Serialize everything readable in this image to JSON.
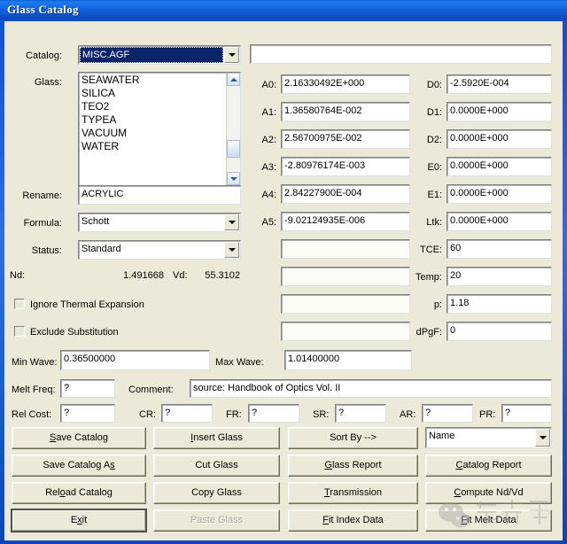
{
  "window": {
    "title": "Glass Catalog"
  },
  "catalog": {
    "label": "Catalog:",
    "value": "MISC.AGF",
    "options": [
      "MISC.AGF"
    ]
  },
  "top_field": {
    "value": "",
    "placeholder": ""
  },
  "glass": {
    "label": "Glass:",
    "items": [
      "SEAWATER",
      "SILICA",
      "TEO2",
      "TYPEA",
      "VACUUM",
      "WATER"
    ],
    "selected": ""
  },
  "rename": {
    "label": "Rename:",
    "value": "ACRYLIC"
  },
  "formula": {
    "label": "Formula:",
    "value": "Schott",
    "options": [
      "Schott"
    ]
  },
  "status": {
    "label": "Status:",
    "value": "Standard",
    "options": [
      "Standard"
    ]
  },
  "indices": {
    "nd_label": "Nd:",
    "nd_value": "1.491668",
    "vd_label": "Vd:",
    "vd_value": "55.3102"
  },
  "checkboxes": [
    {
      "label": "Ignore Thermal Expansion",
      "checked": false
    },
    {
      "label": "Exclude Substitution",
      "checked": false
    }
  ],
  "coefficients_a": [
    {
      "label": "A0:",
      "value": "2.16330492E+000"
    },
    {
      "label": "A1:",
      "value": "1.36580764E-002"
    },
    {
      "label": "A2:",
      "value": "2.56700975E-002"
    },
    {
      "label": "A3:",
      "value": "-2.80976174E-003"
    },
    {
      "label": "A4:",
      "value": "2.84227900E-004"
    },
    {
      "label": "A5:",
      "value": "-9.02124935E-006"
    },
    {
      "label": "",
      "value": ""
    },
    {
      "label": "",
      "value": ""
    },
    {
      "label": "",
      "value": ""
    },
    {
      "label": "",
      "value": ""
    },
    {
      "label": "",
      "value": ""
    }
  ],
  "coefficients_d": [
    {
      "label": "D0:",
      "value": "-2.5920E-004"
    },
    {
      "label": "D1:",
      "value": "0.0000E+000"
    },
    {
      "label": "D2:",
      "value": "0.0000E+000"
    },
    {
      "label": "E0:",
      "value": "0.0000E+000"
    },
    {
      "label": "E1:",
      "value": "0.0000E+000"
    },
    {
      "label": "Ltk:",
      "value": "0.0000E+000"
    },
    {
      "label": "TCE:",
      "value": "60"
    },
    {
      "label": "Temp:",
      "value": "20"
    },
    {
      "label": "p:",
      "value": "1.18"
    },
    {
      "label": "dPgF:",
      "value": "0"
    }
  ],
  "wave": {
    "min_label": "Min Wave:",
    "min_value": "0.36500000",
    "max_label": "Max Wave:",
    "max_value": "1.01400000"
  },
  "melt": {
    "freq_label": "Melt Freq:",
    "freq_value": "?",
    "comment_label": "Comment:",
    "comment_value": "source:  Handbook of Optics Vol. II"
  },
  "costs": {
    "rel_cost_label": "Rel Cost:",
    "rel_cost_value": "?",
    "fields": [
      {
        "label": "CR:",
        "value": "?"
      },
      {
        "label": "FR:",
        "value": "?"
      },
      {
        "label": "SR:",
        "value": "?"
      },
      {
        "label": "AR:",
        "value": "?"
      },
      {
        "label": "PR:",
        "value": "?"
      }
    ]
  },
  "buttons": {
    "col1": [
      {
        "name": "save-catalog",
        "pre": "",
        "key": "S",
        "post": "ave Catalog",
        "disabled": false,
        "default": false
      },
      {
        "name": "save-catalog-as",
        "pre": "Save Catalog A",
        "key": "s",
        "post": "",
        "disabled": false,
        "default": false
      },
      {
        "name": "reload-catalog",
        "pre": "Rel",
        "key": "o",
        "post": "ad Catalog",
        "disabled": false,
        "default": false
      },
      {
        "name": "exit",
        "pre": "E",
        "key": "x",
        "post": "it",
        "disabled": false,
        "default": true
      }
    ],
    "col2": [
      {
        "name": "insert-glass",
        "pre": "",
        "key": "I",
        "post": "nsert Glass",
        "disabled": false,
        "default": false
      },
      {
        "name": "cut-glass",
        "pre": "Cut Glass",
        "key": "",
        "post": "",
        "disabled": false,
        "default": false
      },
      {
        "name": "copy-glass",
        "pre": "Copy Glass",
        "key": "",
        "post": "",
        "disabled": false,
        "default": false
      },
      {
        "name": "paste-glass",
        "pre": "Paste Glass",
        "key": "",
        "post": "",
        "disabled": true,
        "default": false
      }
    ],
    "col3": [
      {
        "name": "sort-by",
        "pre": "Sort By -->",
        "key": "",
        "post": "",
        "disabled": false,
        "default": false
      },
      {
        "name": "glass-report",
        "pre": "",
        "key": "G",
        "post": "lass Report",
        "disabled": false,
        "default": false
      },
      {
        "name": "transmission",
        "pre": "",
        "key": "T",
        "post": "ransmission",
        "disabled": false,
        "default": false
      },
      {
        "name": "fit-index-data",
        "pre": "",
        "key": "F",
        "post": "it Index Data",
        "disabled": false,
        "default": false
      }
    ],
    "col4": [
      {
        "name": "catalog-report",
        "pre": "",
        "key": "C",
        "post": "atalog Report",
        "disabled": false,
        "default": false
      },
      {
        "name": "compute-nd-vd",
        "pre": "",
        "key": "C",
        "post": "ompute Nd/Vd",
        "disabled": false,
        "default": false
      },
      {
        "name": "fit-melt-data",
        "pre": "",
        "key": "F",
        "post": "it Melt Data",
        "disabled": false,
        "default": false
      }
    ]
  },
  "sort_by": {
    "value": "Name",
    "options": [
      "Name"
    ]
  }
}
